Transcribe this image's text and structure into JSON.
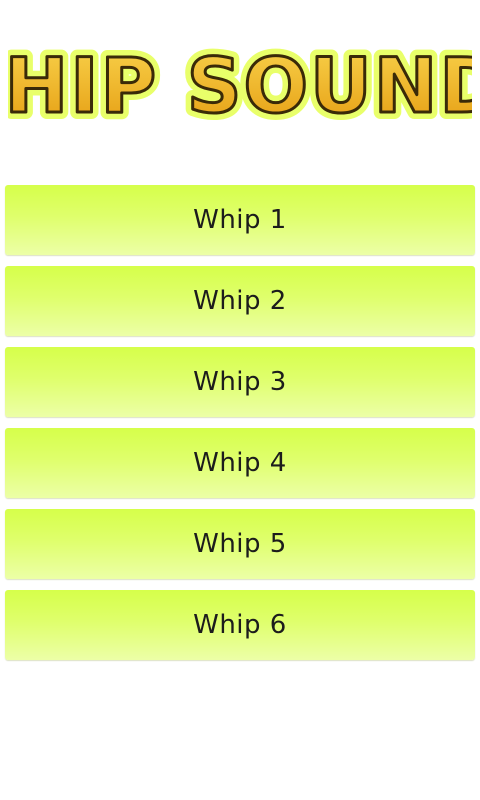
{
  "header": {
    "logo_text": "WHIP SOUNDS"
  },
  "buttons": [
    {
      "label": "Whip 1"
    },
    {
      "label": "Whip 2"
    },
    {
      "label": "Whip 3"
    },
    {
      "label": "Whip 4"
    },
    {
      "label": "Whip 5"
    },
    {
      "label": "Whip 6"
    }
  ],
  "colors": {
    "button_top": "#d6ff4a",
    "button_bottom": "#ecffa7",
    "logo_fill": "#f2b41a",
    "logo_outline": "#3a2a08",
    "logo_glow": "#e9ff6a"
  }
}
